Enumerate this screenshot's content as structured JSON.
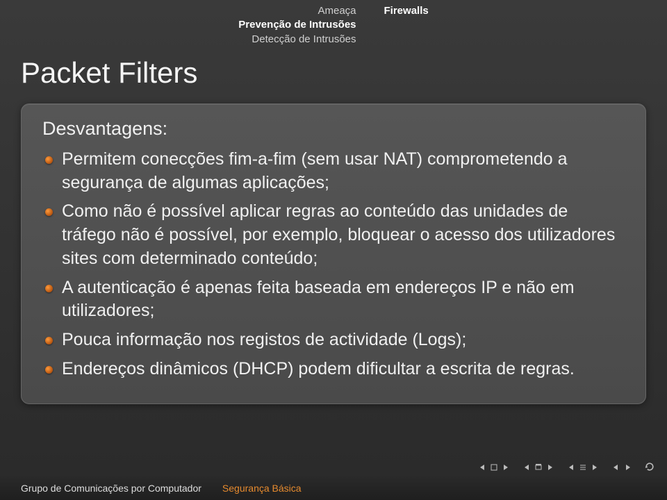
{
  "header": {
    "left": [
      {
        "label": "Ameaça",
        "active": false
      },
      {
        "label": "Prevenção de Intrusões",
        "active": true
      },
      {
        "label": "Detecção de Intrusões",
        "active": false
      }
    ],
    "right": [
      {
        "label": "Firewalls",
        "active": true
      }
    ]
  },
  "slide": {
    "title": "Packet Filters"
  },
  "block": {
    "title": "Desvantagens:",
    "items": [
      "Permitem conecções fim-a-fim (sem usar NAT) comprometendo a segurança de algumas aplicações;",
      "Como não é possível aplicar regras ao conteúdo das unidades de tráfego não é possível, por exemplo, bloquear o acesso dos utilizadores sites com determinado conteúdo;",
      "A autenticação é apenas feita baseada em endereços IP e não em utilizadores;",
      "Pouca informação nos registos de actividade (Logs);",
      "Endereços dinâmicos (DHCP) podem dificultar a escrita de regras."
    ]
  },
  "footer": {
    "left": "Grupo de Comunicações por Computador",
    "right": "Segurança Básica"
  }
}
